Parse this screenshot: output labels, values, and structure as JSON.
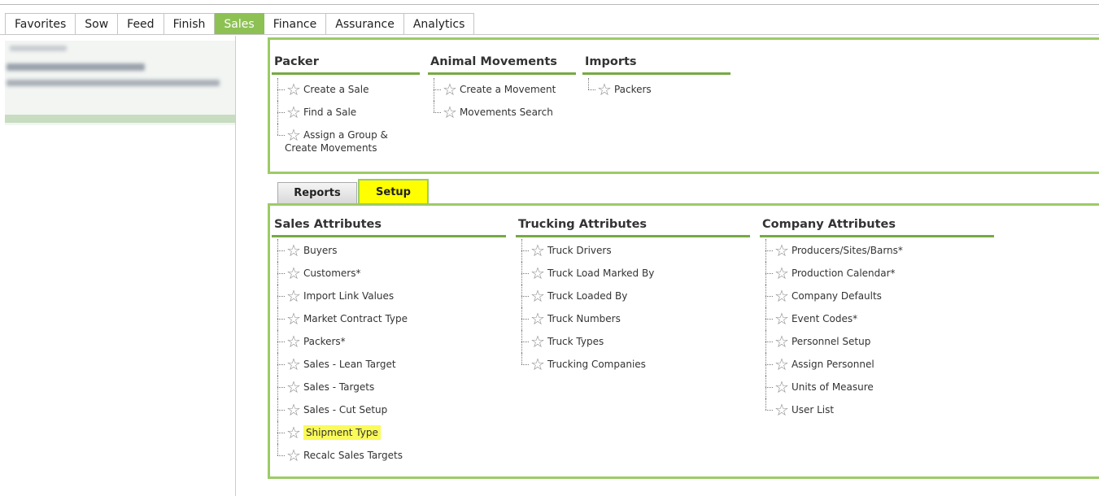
{
  "nav": {
    "tabs": [
      "Favorites",
      "Sow",
      "Feed",
      "Finish",
      "Sales",
      "Finance",
      "Assurance",
      "Analytics"
    ],
    "active": "Sales"
  },
  "colors": {
    "accent": "#8dc154",
    "panel_border": "#9ccb67",
    "highlight": "#ffff00"
  },
  "top_panel": {
    "packer": {
      "title": "Packer",
      "items": [
        "Create a Sale",
        "Find a Sale",
        "Assign a Group & Create Movements"
      ]
    },
    "animal_movements": {
      "title": "Animal Movements",
      "items": [
        "Create a Movement",
        "Movements Search"
      ]
    },
    "imports": {
      "title": "Imports",
      "items": [
        "Packers"
      ]
    }
  },
  "subtabs": {
    "reports": "Reports",
    "setup": "Setup",
    "active": "Setup"
  },
  "bottom_panel": {
    "sales_attributes": {
      "title": "Sales Attributes",
      "items": [
        "Buyers",
        "Customers*",
        "Import Link Values",
        "Market Contract Type",
        "Packers*",
        "Sales - Lean Target",
        "Sales - Targets",
        "Sales - Cut Setup",
        "Shipment Type",
        "Recalc Sales Targets"
      ],
      "highlighted": "Shipment Type"
    },
    "trucking_attributes": {
      "title": "Trucking Attributes",
      "items": [
        "Truck Drivers",
        "Truck Load Marked By",
        "Truck Loaded By",
        "Truck Numbers",
        "Truck Types",
        "Trucking Companies"
      ]
    },
    "company_attributes": {
      "title": "Company Attributes",
      "items": [
        "Producers/Sites/Barns*",
        "Production Calendar*",
        "Company Defaults",
        "Event Codes*",
        "Personnel Setup",
        "Assign Personnel",
        "Units of Measure",
        "User List"
      ]
    }
  },
  "icons": {
    "favorite": "star-outline-icon"
  }
}
